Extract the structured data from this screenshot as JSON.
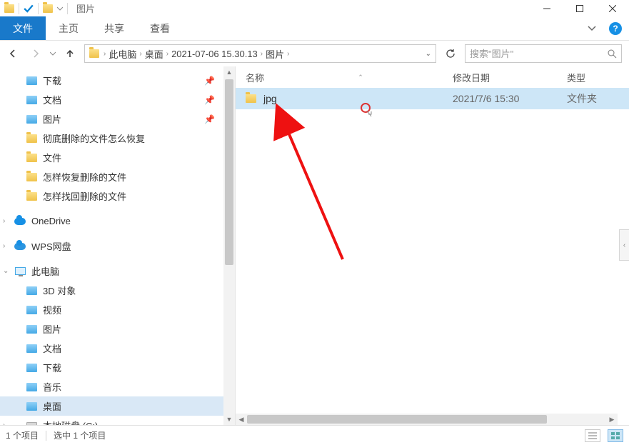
{
  "title": "图片",
  "ribbon": {
    "file": "文件",
    "home": "主页",
    "share": "共享",
    "view": "查看"
  },
  "breadcrumb": [
    "此电脑",
    "桌面",
    "2021-07-06 15.30.13",
    "图片"
  ],
  "search_placeholder": "搜索\"图片\"",
  "columns": {
    "name": "名称",
    "date": "修改日期",
    "type": "类型"
  },
  "rows": [
    {
      "name": "jpg",
      "date": "2021/7/6 15:30",
      "type": "文件夹"
    }
  ],
  "nav": {
    "quick": [
      {
        "label": "下载",
        "pin": true,
        "icon": "download"
      },
      {
        "label": "文档",
        "pin": true,
        "icon": "docs"
      },
      {
        "label": "图片",
        "pin": true,
        "icon": "pics"
      },
      {
        "label": "彻底删除的文件怎么恢复",
        "icon": "folder"
      },
      {
        "label": "文件",
        "icon": "folder"
      },
      {
        "label": "怎样恢复删除的文件",
        "icon": "folder"
      },
      {
        "label": "怎样找回删除的文件",
        "icon": "folder"
      }
    ],
    "onedrive": "OneDrive",
    "wps": "WPS网盘",
    "thispc": "此电脑",
    "pcitems": [
      {
        "label": "3D 对象"
      },
      {
        "label": "视频"
      },
      {
        "label": "图片"
      },
      {
        "label": "文档"
      },
      {
        "label": "下载"
      },
      {
        "label": "音乐"
      },
      {
        "label": "桌面",
        "selected": true
      },
      {
        "label": "本地磁盘 (C:)",
        "icon": "drive"
      }
    ]
  },
  "status": {
    "count": "1 个项目",
    "selected": "选中 1 个项目"
  }
}
